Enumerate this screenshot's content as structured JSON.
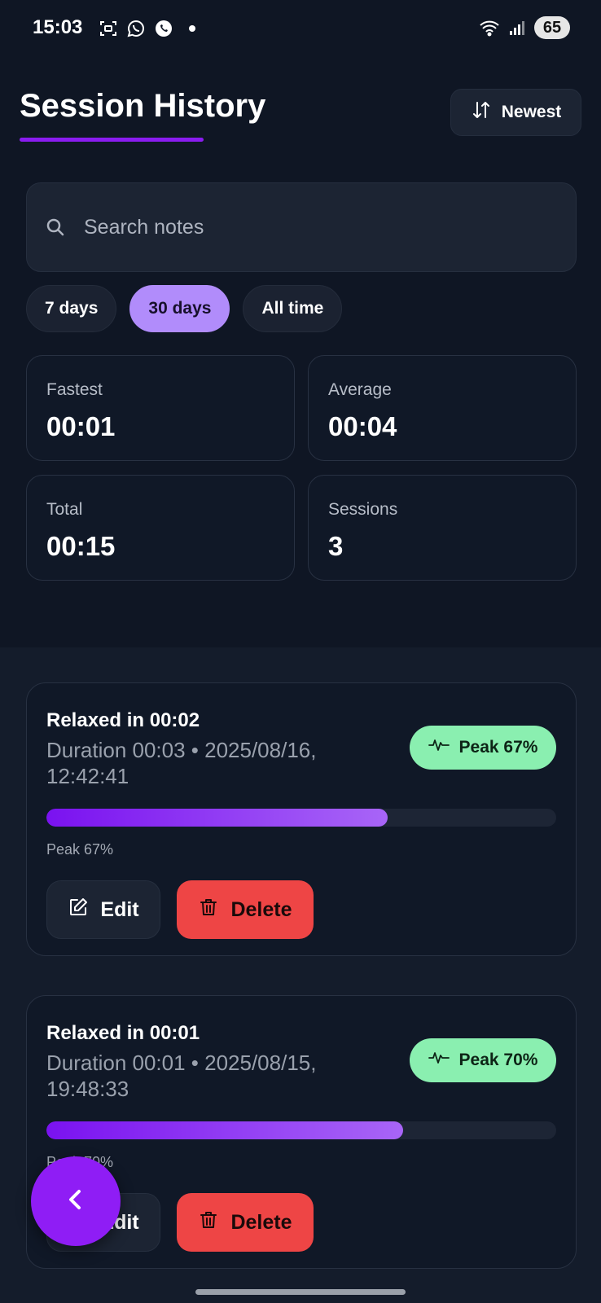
{
  "status_bar": {
    "time": "15:03",
    "battery": "65",
    "left_icons": [
      "screenshot-icon",
      "whatsapp-icon",
      "viber-icon"
    ],
    "right_icons": [
      "wifi-icon",
      "signal-icon"
    ]
  },
  "header": {
    "title": "Session History",
    "sort_label": "Newest",
    "accent_color": "#8a1cf0"
  },
  "search": {
    "placeholder": "Search notes",
    "value": ""
  },
  "filters": [
    {
      "label": "7 days",
      "active": false
    },
    {
      "label": "30 days",
      "active": true
    },
    {
      "label": "All time",
      "active": false
    }
  ],
  "stats": [
    {
      "label": "Fastest",
      "value": "00:01"
    },
    {
      "label": "Average",
      "value": "00:04"
    },
    {
      "label": "Total",
      "value": "00:15"
    },
    {
      "label": "Sessions",
      "value": "3"
    }
  ],
  "sessions": [
    {
      "title": "Relaxed in 00:02",
      "meta_line1": "Duration 00:03 • 2025/08/16,",
      "meta_line2": "12:42:41",
      "peak_badge": "Peak 67%",
      "peak_percent": 67,
      "progress_label": "Peak 67%",
      "edit_label": "Edit",
      "delete_label": "Delete"
    },
    {
      "title": "Relaxed in 00:01",
      "meta_line1": "Duration 00:01 • 2025/08/15,",
      "meta_line2": "19:48:33",
      "peak_badge": "Peak 70%",
      "peak_percent": 70,
      "progress_label": "Peak 70%",
      "edit_label": "Edit",
      "delete_label": "Delete"
    }
  ],
  "colors": {
    "peak_badge_bg": "#8aefb0",
    "delete_bg": "#ee4545",
    "chip_active_bg": "#b18cfb",
    "fab_bg": "#8f1df5"
  }
}
